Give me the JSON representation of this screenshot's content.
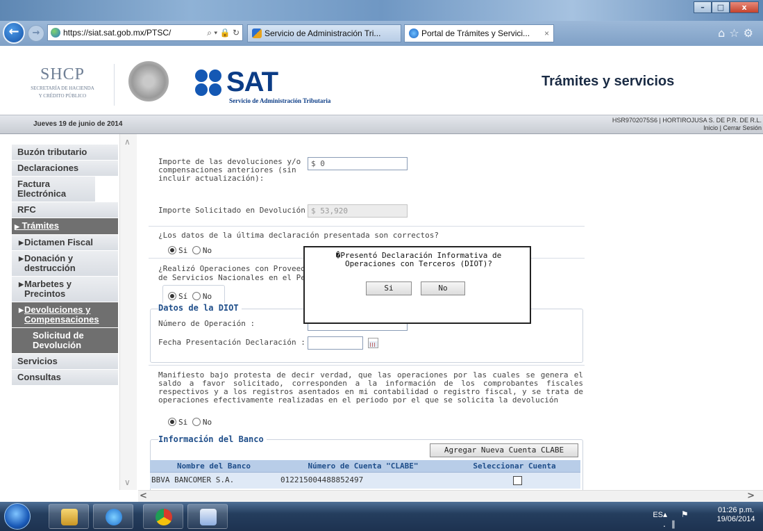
{
  "browser": {
    "url": "https://siat.sat.gob.mx/PTSC/",
    "address_controls": "⌕ ▾ 🔒 ↻",
    "tabs": [
      {
        "label": "Servicio de Administración Tri..."
      },
      {
        "label": "Portal de Trámites y Servici...",
        "close": "×"
      }
    ],
    "window_controls": {
      "minimize": "–",
      "maximize": "□",
      "close": "x"
    },
    "toolbar_icons": "⌂☆⚙",
    "back_glyph": "←",
    "forward_glyph": "→"
  },
  "header": {
    "shcp_title": "SHCP",
    "shcp_subtitle_1": "SECRETARÍA DE HACIENDA",
    "shcp_subtitle_2": "Y CRÉDITO PÚBLICO",
    "sat_title": "SAT",
    "sat_subtitle": "Servicio de Administración Tributaria",
    "section_title": "Trámites y servicios"
  },
  "infobar": {
    "date": "Jueves 19 de junio de 2014",
    "user": "HSR9702075S6 | HORTIROJUSA S. DE P.R. DE R.L.",
    "inicio": "Inicio",
    "separator": "|",
    "cerrar": "Cerrar Sesión"
  },
  "menu": {
    "triangle": "▶",
    "items": [
      {
        "label": "Buzón tributario"
      },
      {
        "label": "Declaraciones"
      },
      {
        "label": "Factura Electrónica"
      },
      {
        "label": "RFC"
      },
      {
        "label": "Trámites"
      },
      {
        "label": "Dictamen Fiscal"
      },
      {
        "label": "Donación y destrucción"
      },
      {
        "label": "Marbetes y Precintos"
      },
      {
        "label": "Devoluciones y Compensaciones"
      },
      {
        "label": "Solicitud de Devolución"
      },
      {
        "label": "Servicios"
      },
      {
        "label": "Consultas"
      }
    ],
    "scroll_up": "∧",
    "scroll_down": "∨"
  },
  "form": {
    "importe_devoluciones_label": "Importe de las devoluciones y/o compensaciones anteriores (sin incluir actualización):",
    "importe_devoluciones_value": "$ 0",
    "importe_solicitado_label": "Importe Solicitado en Devolución :",
    "importe_solicitado_value": "$ 53,920",
    "q1": "¿Los datos de la última declaración presentada son correctos?",
    "q2": "¿Realizó Operaciones con Proveedores",
    "q2b": "de Servicios Nacionales en el Perio",
    "si": "Si",
    "si_acc": "Sí",
    "no": "No",
    "diot_title": "Datos de la DIOT",
    "num_operacion_label": "Número de Operación :",
    "num_operacion_value": "",
    "fecha_label": "Fecha Presentación Declaración :",
    "fecha_value": "",
    "manifiesto": "Manifiesto bajo protesta de decir verdad, que las operaciones por las cuales se genera el saldo a favor solicitado, corresponden a la información de los comprobantes fiscales respectivos y a los registros asentados en mi contabilidad o registro fiscal, y se trata de operaciones efectivamente realizadas en el periodo por el que se solicita la devolución",
    "banco_title": "Información del Banco",
    "agregar_cuenta": "Agregar Nueva Cuenta CLABE",
    "table_headers": [
      "Nombre del Banco",
      "Número de Cuenta \"CLABE\"",
      "Seleccionar Cuenta"
    ],
    "table_rows": [
      {
        "banco": "BBVA BANCOMER S.A.",
        "cuenta": "012215004488852497"
      }
    ]
  },
  "dialog": {
    "message": "�Presentó Declaración Informativa de Operaciones con Terceros (DIOT)?",
    "yes": "Si",
    "no": "No"
  },
  "scroll": {
    "left": "<",
    "right": ">"
  },
  "taskbar": {
    "language": "ES",
    "tray_icons": "▴ ⚑ .∥",
    "time": "01:26 p.m.",
    "date": "19/06/2014"
  }
}
